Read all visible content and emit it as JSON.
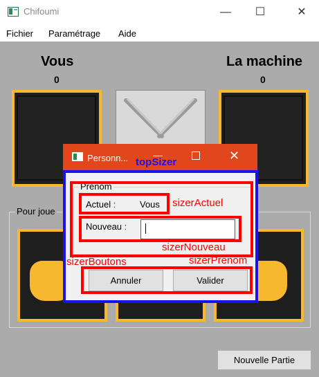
{
  "window": {
    "title": "Chifoumi",
    "controls": {
      "minimize": "—",
      "maximize": "☐",
      "close": "✕"
    }
  },
  "menu": [
    "Fichier",
    "Paramétrage",
    "Aide"
  ],
  "game": {
    "player_left": {
      "name": "Vous",
      "score": "0"
    },
    "player_right": {
      "name": "La machine",
      "score": "0"
    },
    "group_label": "Pour joue",
    "new_game_button": "Nouvelle Partie"
  },
  "dialog": {
    "title": "Personn...",
    "minimize": "—",
    "close": "✕",
    "groupbox_label": "Prenom",
    "actuel_label": "Actuel :",
    "actuel_value": "Vous",
    "nouveau_label": "Nouveau :",
    "nouveau_value": "",
    "cancel_button": "Annuler",
    "ok_button": "Valider"
  },
  "annotations": {
    "top_sizer": "topSizer",
    "sizer_actuel": "sizerActuel",
    "sizer_nouveau": "sizerNouveau",
    "sizer_boutons": "sizerBoutons",
    "sizer_prenom": "sizerPrenom"
  },
  "colors": {
    "accent_orange": "#f5b82e",
    "dialog_title": "#e2461d",
    "sizer_red": "#ff0000",
    "sizer_blue": "#1a12e6"
  }
}
